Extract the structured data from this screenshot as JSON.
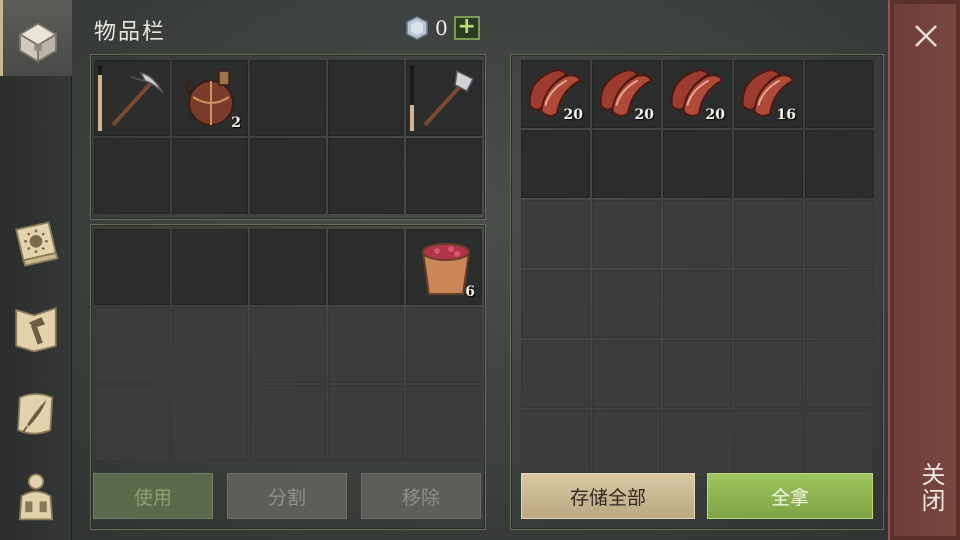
{
  "title": "物品栏",
  "currency": {
    "icon": "gem-icon",
    "value": "0",
    "add_label": "+"
  },
  "sidebar": [
    {
      "name": "storage-chest",
      "icon": "chest-icon",
      "active": true
    },
    {
      "name": "journal",
      "icon": "sun-book-icon",
      "active": false
    },
    {
      "name": "crafting",
      "icon": "hammer-map-icon",
      "active": false
    },
    {
      "name": "quests",
      "icon": "scroll-feather-icon",
      "active": false
    },
    {
      "name": "character",
      "icon": "character-icon",
      "active": false
    }
  ],
  "inventory": {
    "hotbar": [
      {
        "item": "pickaxe",
        "durability": 0.85
      },
      {
        "item": "flask",
        "count": "2"
      },
      {},
      {},
      {
        "item": "hatchet",
        "durability": 0.4
      },
      {},
      {},
      {},
      {},
      {}
    ],
    "backpack": [
      {},
      {},
      {},
      {},
      {
        "item": "berry-bucket",
        "count": "6"
      },
      {},
      {},
      {},
      {},
      {},
      {},
      {},
      {},
      {},
      {}
    ],
    "buttons": {
      "use": "使用",
      "split": "分割",
      "remove": "移除"
    }
  },
  "container": {
    "slots": [
      {
        "item": "raw-meat",
        "count": "20"
      },
      {
        "item": "raw-meat",
        "count": "20"
      },
      {
        "item": "raw-meat",
        "count": "20"
      },
      {
        "item": "raw-meat",
        "count": "16"
      },
      {}
    ],
    "buttons": {
      "store_all": "存储全部",
      "take_all": "全拿"
    }
  },
  "close": {
    "label": "关闭"
  }
}
